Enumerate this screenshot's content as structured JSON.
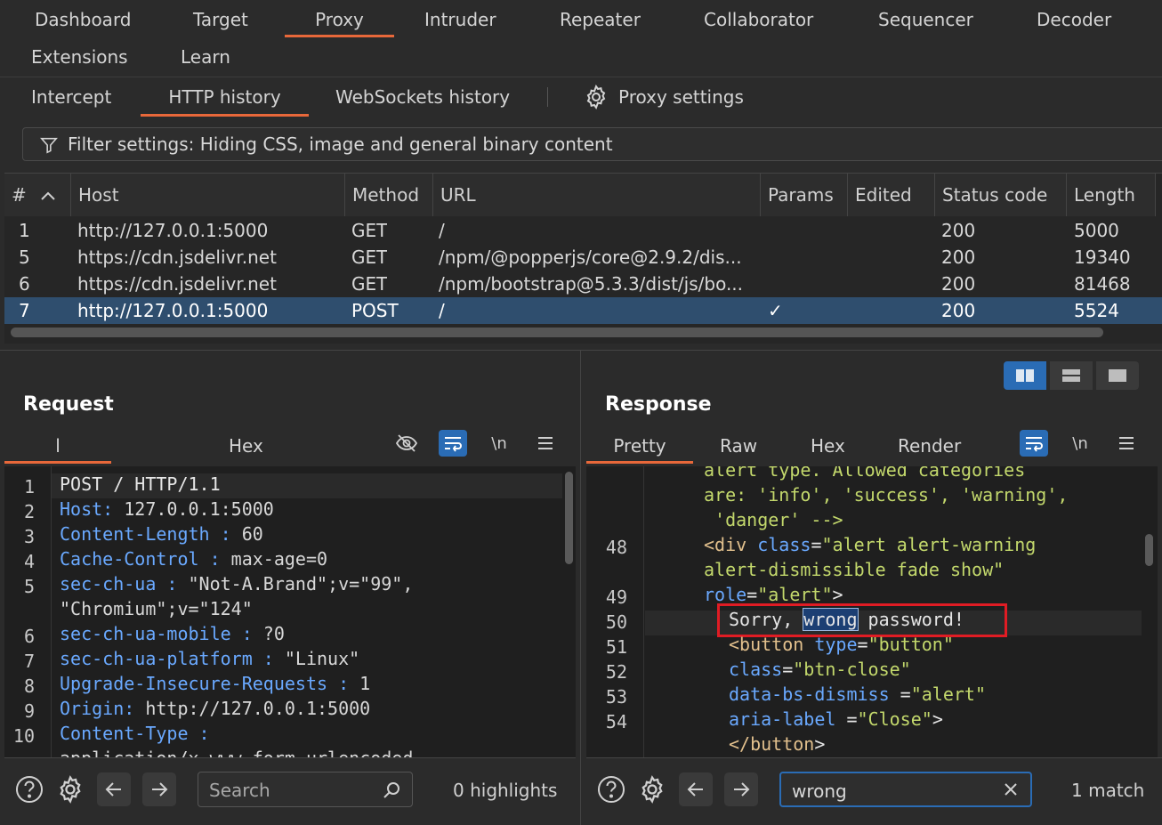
{
  "top_tabs": [
    "Dashboard",
    "Target",
    "Proxy",
    "Intruder",
    "Repeater",
    "Collaborator",
    "Sequencer",
    "Decoder",
    "Extensions",
    "Learn"
  ],
  "sub_tabs": [
    "Intercept",
    "HTTP history",
    "WebSockets history"
  ],
  "proxy_settings": "Proxy settings",
  "filter_text": "Filter settings: Hiding CSS, image and general binary content",
  "table": {
    "headers": [
      "#",
      "Host",
      "Method",
      "URL",
      "Params",
      "Edited",
      "Status code",
      "Length"
    ],
    "rows": [
      {
        "num": "1",
        "host": "http://127.0.0.1:5000",
        "method": "GET",
        "url": "/",
        "params": "",
        "status": "200",
        "length": "5000"
      },
      {
        "num": "5",
        "host": "https://cdn.jsdelivr.net",
        "method": "GET",
        "url": "/npm/@popperjs/core@2.9.2/dis...",
        "params": "",
        "status": "200",
        "length": "19340"
      },
      {
        "num": "6",
        "host": "https://cdn.jsdelivr.net",
        "method": "GET",
        "url": "/npm/bootstrap@5.3.3/dist/js/bo...",
        "params": "",
        "status": "200",
        "length": "81468"
      },
      {
        "num": "7",
        "host": "http://127.0.0.1:5000",
        "method": "POST",
        "url": "/",
        "params": "✓",
        "status": "200",
        "length": "5524"
      }
    ]
  },
  "request": {
    "title": "Request",
    "tabs": [
      "l",
      "Hex"
    ],
    "newline_label": "\\n",
    "lines": [
      {
        "n": "1",
        "k": "POST / HTTP/1.1",
        "v": ""
      },
      {
        "n": "2",
        "k": "Host:",
        "v": " 127.0.0.1:5000"
      },
      {
        "n": "3",
        "k": "Content-Length :",
        "v": " 60"
      },
      {
        "n": "4",
        "k": "Cache-Control :",
        "v": " max-age=0"
      },
      {
        "n": "5",
        "k": "sec-ch-ua :",
        "v": " \"Not-A.Brand\";v=\"99\","
      },
      {
        "n": "",
        "k": "",
        "v": "\"Chromium\";v=\"124\""
      },
      {
        "n": "6",
        "k": "sec-ch-ua-mobile :",
        "v": " ?0"
      },
      {
        "n": "7",
        "k": "sec-ch-ua-platform :",
        "v": " \"Linux\""
      },
      {
        "n": "8",
        "k": "Upgrade-Insecure-Requests :",
        "v": " 1"
      },
      {
        "n": "9",
        "k": "Origin:",
        "v": " http://127.0.0.1:5000"
      },
      {
        "n": "10",
        "k": "Content-Type :",
        "v": ""
      },
      {
        "n": "",
        "k": "",
        "v": "application/x-www-form-urlencoded"
      }
    ],
    "search_placeholder": "Search",
    "highlights": "0 highlights"
  },
  "response": {
    "title": "Response",
    "tabs": [
      "Pretty",
      "Raw",
      "Hex",
      "Render"
    ],
    "newline_label": "\\n",
    "lines": [
      {
        "n": "",
        "t": "alert type. Allowed categories"
      },
      {
        "n": "",
        "t": "are: 'info', 'success', 'warning',"
      },
      {
        "n": "",
        "t": " 'danger' -->"
      },
      {
        "n": "48",
        "t": "<div class=\"alert alert-warning"
      },
      {
        "n": "",
        "t": "alert-dismissible fade show\""
      },
      {
        "n": "49",
        "t": "role=\"alert\">"
      },
      {
        "n": "50",
        "t": "  Sorry, wrong password!"
      },
      {
        "n": "51",
        "t": "  <button type=\"button\""
      },
      {
        "n": "52",
        "t": "  class=\"btn-close\""
      },
      {
        "n": "53",
        "t": "  data-bs-dismiss =\"alert\""
      },
      {
        "n": "54",
        "t": "  aria-label =\"Close\">"
      },
      {
        "n": "",
        "t": "  </button>"
      }
    ],
    "sorry_pre": "Sorry, ",
    "sorry_match": "wrong",
    "sorry_post": " password!",
    "search_value": "wrong",
    "matches": "1 match"
  },
  "colors": {
    "accent": "#e8683a",
    "selected_row": "#2f4e6e",
    "toggle_on": "#2a6cb5",
    "highlight_box": "#e01c24"
  }
}
